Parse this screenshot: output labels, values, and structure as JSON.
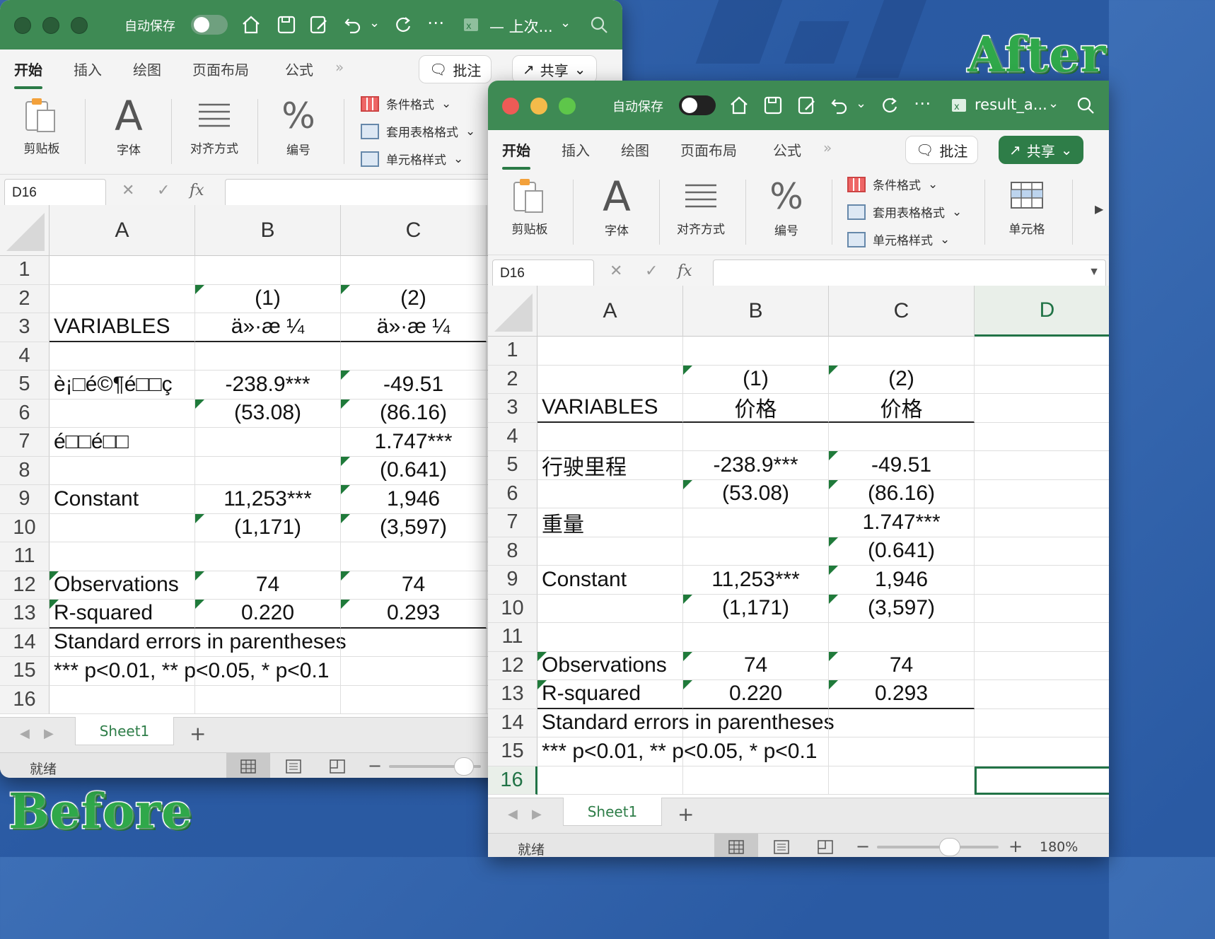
{
  "labels": {
    "before": "Before",
    "after": "After"
  },
  "colors": {
    "excel_green": "#3e8a54",
    "accent": "#217346"
  },
  "before_window": {
    "autosave": "自动保存",
    "doc_title": "— 上次...",
    "tabs": [
      "开始",
      "插入",
      "绘图",
      "页面布局",
      "公式"
    ],
    "more_tabs": "»",
    "comment_btn": "批注",
    "share_btn": "共享",
    "ribbon": {
      "clipboard": "剪贴板",
      "font": "字体",
      "align": "对齐方式",
      "number": "编号",
      "cond_format": "条件格式",
      "table_format": "套用表格格式",
      "cell_style": "单元格样式"
    },
    "name_box": "D16",
    "fx": "fx",
    "columns": [
      "A",
      "B",
      "C"
    ],
    "rows": [
      [
        "",
        "",
        ""
      ],
      [
        "",
        "(1)",
        "(2)"
      ],
      [
        "VARIABLES",
        "ä»·æ ¼",
        "ä»·æ ¼"
      ],
      [
        "",
        "",
        ""
      ],
      [
        "è¡□é©¶é□□ç",
        "-238.9***",
        "-49.51"
      ],
      [
        "",
        "(53.08)",
        "(86.16)"
      ],
      [
        "é□□é□□",
        "",
        "1.747***"
      ],
      [
        "",
        "",
        "(0.641)"
      ],
      [
        "Constant",
        "11,253***",
        "1,946"
      ],
      [
        "",
        "(1,171)",
        "(3,597)"
      ],
      [
        "",
        "",
        ""
      ],
      [
        "Observations",
        "74",
        "74"
      ],
      [
        "R-squared",
        "0.220",
        "0.293"
      ],
      [
        "Standard errors in parentheses",
        "",
        ""
      ],
      [
        "*** p<0.01, ** p<0.05, * p<0.1",
        "",
        ""
      ],
      [
        "",
        "",
        ""
      ]
    ],
    "sheet_tab": "Sheet1",
    "add_sheet": "+",
    "status": "就绪"
  },
  "after_window": {
    "autosave": "自动保存",
    "doc_title": "result_a...",
    "tabs": [
      "开始",
      "插入",
      "绘图",
      "页面布局",
      "公式"
    ],
    "more_tabs": "»",
    "comment_btn": "批注",
    "share_btn": "共享",
    "ribbon": {
      "clipboard": "剪贴板",
      "font": "字体",
      "align": "对齐方式",
      "number": "编号",
      "cond_format": "条件格式",
      "table_format": "套用表格格式",
      "cell_style": "单元格样式",
      "cells": "单元格"
    },
    "name_box": "D16",
    "fx": "fx",
    "columns": [
      "A",
      "B",
      "C",
      "D"
    ],
    "rows": [
      [
        "",
        "",
        "",
        ""
      ],
      [
        "",
        "(1)",
        "(2)",
        ""
      ],
      [
        "VARIABLES",
        "价格",
        "价格",
        ""
      ],
      [
        "",
        "",
        "",
        ""
      ],
      [
        "行驶里程",
        "-238.9***",
        "-49.51",
        ""
      ],
      [
        "",
        "(53.08)",
        "(86.16)",
        ""
      ],
      [
        "重量",
        "",
        "1.747***",
        ""
      ],
      [
        "",
        "",
        "(0.641)",
        ""
      ],
      [
        "Constant",
        "11,253***",
        "1,946",
        ""
      ],
      [
        "",
        "(1,171)",
        "(3,597)",
        ""
      ],
      [
        "",
        "",
        "",
        ""
      ],
      [
        "Observations",
        "74",
        "74",
        ""
      ],
      [
        "R-squared",
        "0.220",
        "0.293",
        ""
      ],
      [
        "Standard errors in parentheses",
        "",
        "",
        ""
      ],
      [
        "*** p<0.01, ** p<0.05, * p<0.1",
        "",
        "",
        ""
      ],
      [
        "",
        "",
        "",
        ""
      ]
    ],
    "sheet_tab": "Sheet1",
    "add_sheet": "+",
    "status": "就绪",
    "zoom": "180%"
  }
}
